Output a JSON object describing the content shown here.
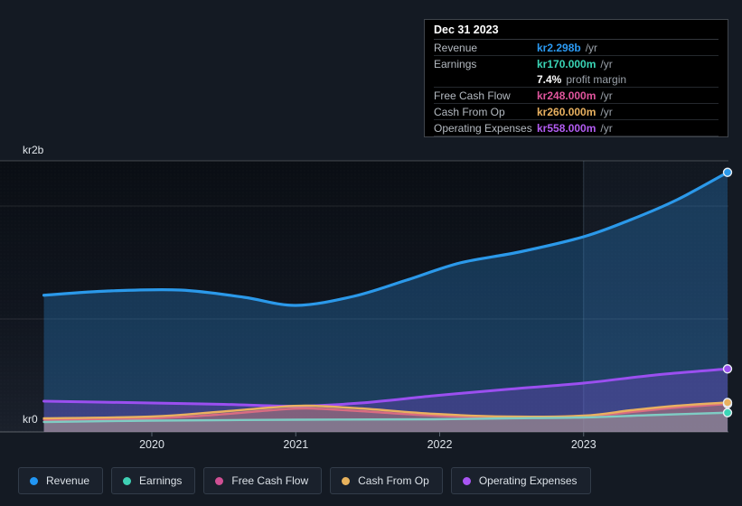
{
  "axes": {
    "y_top_label": "kr2b",
    "y_zero_label": "kr0"
  },
  "tooltip": {
    "date": "Dec 31 2023",
    "rows": [
      {
        "label": "Revenue",
        "value": "kr2.298b",
        "suffix": "/yr",
        "color": "#2b9af3"
      },
      {
        "label": "Earnings",
        "value": "kr170.000m",
        "suffix": "/yr",
        "color": "#3ad5b6"
      },
      {
        "label": "",
        "value": "7.4%",
        "suffix": "profit margin",
        "color": "#ffffff"
      },
      {
        "label": "Free Cash Flow",
        "value": "kr248.000m",
        "suffix": "/yr",
        "color": "#e0559d"
      },
      {
        "label": "Cash From Op",
        "value": "kr260.000m",
        "suffix": "/yr",
        "color": "#e9b160"
      },
      {
        "label": "Operating Expenses",
        "value": "kr558.000m",
        "suffix": "/yr",
        "color": "#b35cf2"
      }
    ]
  },
  "legend": [
    {
      "label": "Revenue",
      "color": "#2196f3"
    },
    {
      "label": "Earnings",
      "color": "#3fd0b4"
    },
    {
      "label": "Free Cash Flow",
      "color": "#cf4f93"
    },
    {
      "label": "Cash From Op",
      "color": "#e8b25c"
    },
    {
      "label": "Operating Expenses",
      "color": "#a855f2"
    }
  ],
  "chart_data": {
    "type": "area",
    "title": "",
    "currency": "kr",
    "ylabel": "",
    "xlabel": "",
    "y_unit": "millions",
    "y_range_millions": [
      0,
      2400
    ],
    "gridlines_millions": [
      2400,
      2000,
      1000,
      0
    ],
    "y_gridline_labels": {
      "2000": "kr2b",
      "0": "kr0"
    },
    "x_range_years": [
      2019.25,
      2024.0
    ],
    "x_ticks": [
      {
        "label": "2020",
        "year": 2020
      },
      {
        "label": "2021",
        "year": 2021
      },
      {
        "label": "2022",
        "year": 2022
      },
      {
        "label": "2023",
        "year": 2023
      }
    ],
    "highlight_from_year": 2023,
    "legend_position": "bottom",
    "series": [
      {
        "name": "Revenue",
        "z": 1,
        "width": 3.2,
        "color": "#2b99ea",
        "fill": "rgba(42,140,220,0.30)",
        "points": [
          [
            2019.25,
            1210
          ],
          [
            2019.7,
            1248
          ],
          [
            2020.2,
            1256
          ],
          [
            2020.64,
            1192
          ],
          [
            2021.0,
            1120
          ],
          [
            2021.4,
            1200
          ],
          [
            2021.77,
            1344
          ],
          [
            2022.14,
            1496
          ],
          [
            2022.55,
            1592
          ],
          [
            2023.0,
            1728
          ],
          [
            2023.33,
            1880
          ],
          [
            2023.65,
            2056
          ],
          [
            2024.0,
            2298
          ]
        ]
      },
      {
        "name": "Operating Expenses",
        "z": 2,
        "width": 3,
        "color": "#9b4ff0",
        "fill": "rgba(140,75,230,0.28)",
        "points": [
          [
            2019.25,
            272
          ],
          [
            2020.0,
            256
          ],
          [
            2020.5,
            244
          ],
          [
            2021.0,
            228
          ],
          [
            2021.45,
            256
          ],
          [
            2021.96,
            320
          ],
          [
            2022.46,
            376
          ],
          [
            2023.0,
            432
          ],
          [
            2023.5,
            504
          ],
          [
            2024.0,
            558
          ]
        ]
      },
      {
        "name": "Free Cash Flow",
        "z": 3,
        "width": 2.4,
        "color": "#d4548e",
        "fill": "rgba(210,80,150,0.22)",
        "points": [
          [
            2019.25,
            108
          ],
          [
            2020.0,
            120
          ],
          [
            2020.45,
            152
          ],
          [
            2020.83,
            192
          ],
          [
            2021.08,
            208
          ],
          [
            2021.45,
            184
          ],
          [
            2021.96,
            144
          ],
          [
            2022.46,
            128
          ],
          [
            2023.0,
            136
          ],
          [
            2023.33,
            176
          ],
          [
            2023.65,
            216
          ],
          [
            2024.0,
            248
          ]
        ]
      },
      {
        "name": "Cash From Op",
        "z": 4,
        "width": 2.4,
        "color": "#e9b160",
        "fill": "rgba(233,177,96,0.26)",
        "points": [
          [
            2019.25,
            120
          ],
          [
            2020.0,
            136
          ],
          [
            2020.45,
            176
          ],
          [
            2020.83,
            216
          ],
          [
            2021.08,
            232
          ],
          [
            2021.45,
            208
          ],
          [
            2021.96,
            160
          ],
          [
            2022.46,
            136
          ],
          [
            2023.0,
            144
          ],
          [
            2023.33,
            192
          ],
          [
            2023.65,
            232
          ],
          [
            2024.0,
            260
          ]
        ]
      },
      {
        "name": "Earnings",
        "z": 5,
        "width": 2.4,
        "color": "#7fccc4",
        "marker_color": "#3ad5b6",
        "fill": "rgba(135,205,205,0.20)",
        "points": [
          [
            2019.25,
            88
          ],
          [
            2020.0,
            100
          ],
          [
            2021.0,
            108
          ],
          [
            2021.96,
            112
          ],
          [
            2022.46,
            120
          ],
          [
            2023.0,
            128
          ],
          [
            2023.45,
            148
          ],
          [
            2024.0,
            170
          ]
        ]
      }
    ]
  }
}
